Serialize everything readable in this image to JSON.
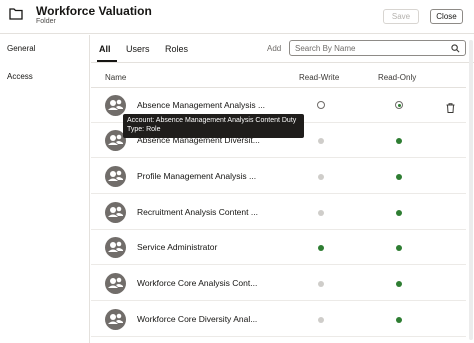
{
  "header": {
    "title": "Workforce Valuation",
    "subtitle": "Folder",
    "save_label": "Save",
    "close_label": "Close",
    "icon": "folder-icon"
  },
  "sidebar": {
    "items": [
      {
        "label": "General"
      },
      {
        "label": "Access"
      }
    ]
  },
  "tabs": [
    {
      "label": "All",
      "active": true
    },
    {
      "label": "Users",
      "active": false
    },
    {
      "label": "Roles",
      "active": false
    }
  ],
  "add_label": "Add",
  "search": {
    "placeholder": "Search By Name"
  },
  "columns": {
    "name": "Name",
    "read_write": "Read-Write",
    "read_only": "Read-Only"
  },
  "rows": [
    {
      "name": "Absence Management Analysis ...",
      "read_write": false,
      "read_only": true,
      "editable": true
    },
    {
      "name": "Absence Management Diversit...",
      "read_write": false,
      "read_only": true,
      "editable": false
    },
    {
      "name": "Profile Management Analysis ...",
      "read_write": false,
      "read_only": true,
      "editable": false
    },
    {
      "name": "Recruitment Analysis Content ...",
      "read_write": false,
      "read_only": true,
      "editable": false
    },
    {
      "name": "Service Administrator",
      "read_write": true,
      "read_only": true,
      "editable": false
    },
    {
      "name": "Workforce Core Analysis Cont...",
      "read_write": false,
      "read_only": true,
      "editable": false
    },
    {
      "name": "Workforce Core Diversity Anal...",
      "read_write": false,
      "read_only": true,
      "editable": false
    }
  ],
  "tooltip": {
    "account": "Account: Absence Management Analysis Content Duty",
    "type": "Type: Role"
  },
  "colors": {
    "accent": "#2e7d32",
    "avatar": "#716d6a"
  }
}
